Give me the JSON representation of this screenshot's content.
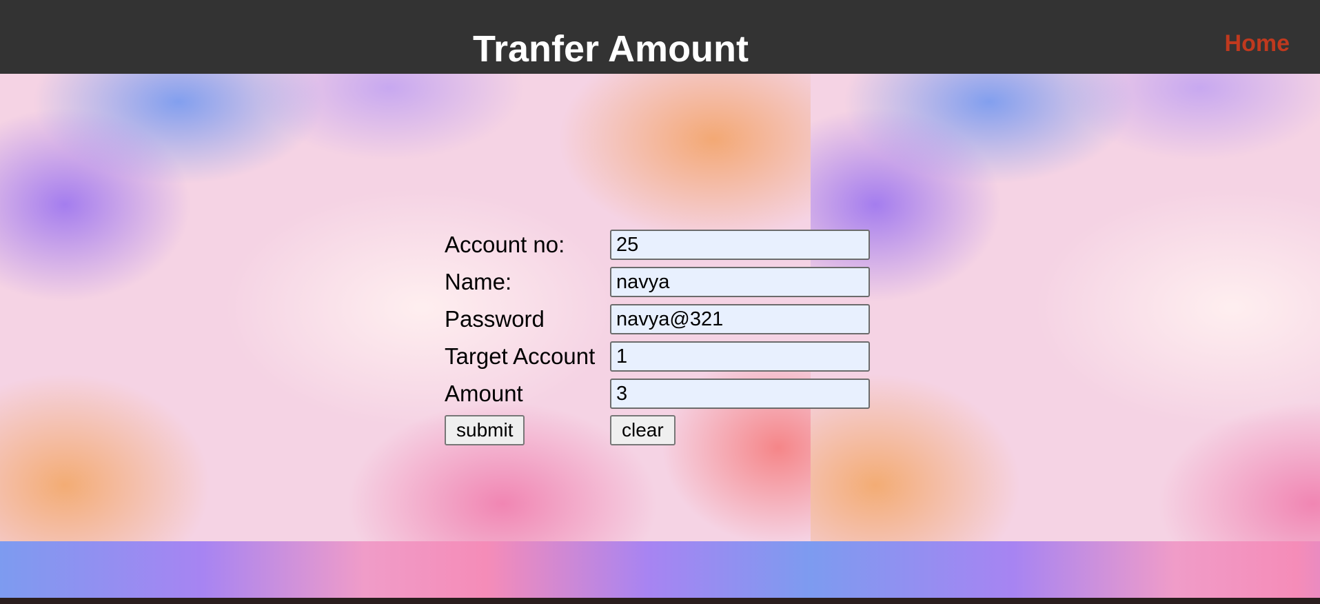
{
  "header": {
    "title": "Tranfer Amount",
    "home_link": "Home"
  },
  "form": {
    "fields": [
      {
        "label": "Account no:",
        "value": "25"
      },
      {
        "label": "Name:",
        "value": "navya"
      },
      {
        "label": "Password",
        "value": "navya@321"
      },
      {
        "label": "Target Account",
        "value": "1"
      },
      {
        "label": "Amount",
        "value": "3"
      }
    ],
    "submit_label": "submit",
    "clear_label": "clear"
  },
  "colors": {
    "header_bg": "#333333",
    "home_link": "#c0391e",
    "input_bg": "#e8f0fe"
  }
}
